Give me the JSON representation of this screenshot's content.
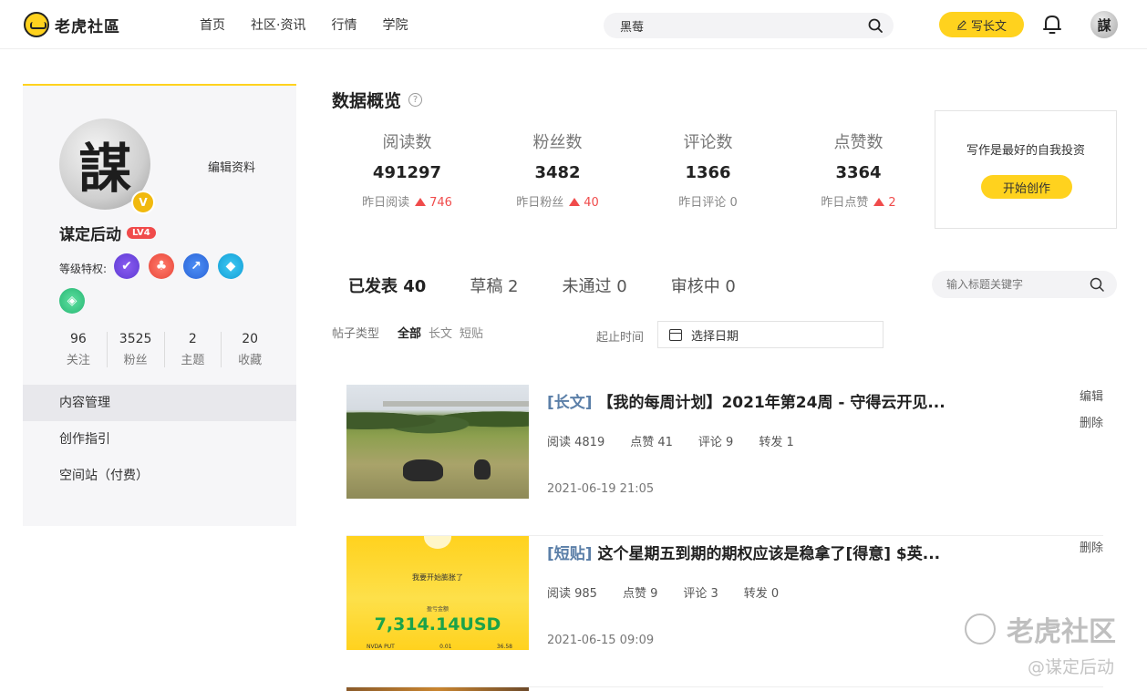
{
  "brand": {
    "name": "老虎社區"
  },
  "nav": {
    "items": [
      "首页",
      "社区·资讯",
      "行情",
      "学院"
    ]
  },
  "search": {
    "value": "黑莓"
  },
  "write_button": {
    "label": "写长文"
  },
  "profile": {
    "avatar_char": "謀",
    "edit_label": "编辑资料",
    "username": "谋定后动",
    "level": "LV4",
    "privilege_label": "等级特权:",
    "stats": [
      {
        "value": "96",
        "label": "关注"
      },
      {
        "value": "3525",
        "label": "粉丝"
      },
      {
        "value": "2",
        "label": "主题"
      },
      {
        "value": "20",
        "label": "收藏"
      }
    ]
  },
  "menu": {
    "items": [
      "内容管理",
      "创作指引",
      "空间站（付费）"
    ]
  },
  "overview": {
    "title": "数据概览",
    "metrics": [
      {
        "title": "阅读数",
        "value": "491297",
        "delta_label": "昨日阅读",
        "delta": "746",
        "up": true
      },
      {
        "title": "粉丝数",
        "value": "3482",
        "delta_label": "昨日粉丝",
        "delta": "40",
        "up": true
      },
      {
        "title": "评论数",
        "value": "1366",
        "delta_label": "昨日评论",
        "delta": "0",
        "up": false
      },
      {
        "title": "点赞数",
        "value": "3364",
        "delta_label": "昨日点赞",
        "delta": "2",
        "up": true
      }
    ],
    "promo": {
      "text": "写作是最好的自我投资",
      "button": "开始创作"
    }
  },
  "tabs": [
    "已发表 40",
    "草稿 2",
    "未通过 0",
    "审核中 0"
  ],
  "title_search": {
    "placeholder": "输入标题关键字"
  },
  "filters": {
    "type_label": "帖子类型",
    "types": [
      "全部",
      "长文",
      "短贴"
    ],
    "date_label": "起止时间",
    "date_placeholder": "选择日期"
  },
  "posts": [
    {
      "tag": "[长文]",
      "title": "【我的每周计划】2021年第24周 - 守得云开见...",
      "stats": [
        "阅读 4819",
        "点赞 41",
        "评论 9",
        "转发 1"
      ],
      "date": "2021-06-19 21:05",
      "actions": [
        "编辑",
        "删除"
      ]
    },
    {
      "tag": "[短贴]",
      "title": "这个星期五到期的期权应该是稳拿了[得意] $英...",
      "stats": [
        "阅读 985",
        "点赞 9",
        "评论 3",
        "转发 0"
      ],
      "date": "2021-06-15 09:09",
      "actions": [
        "删除"
      ],
      "thumb": {
        "line1": "我要开始膨胀了",
        "line2": "盈亏金额",
        "amount": "7,314.14USD",
        "row": [
          "NVDA PUT",
          "0.01",
          "36.58"
        ]
      }
    }
  ],
  "watermark": {
    "brand": "老虎社区",
    "author": "@谋定后动"
  },
  "colors": {
    "accent": "#ffd21e",
    "up": "#f04b4b",
    "tag": "#5b7fa8",
    "level": "#f04b4b"
  }
}
